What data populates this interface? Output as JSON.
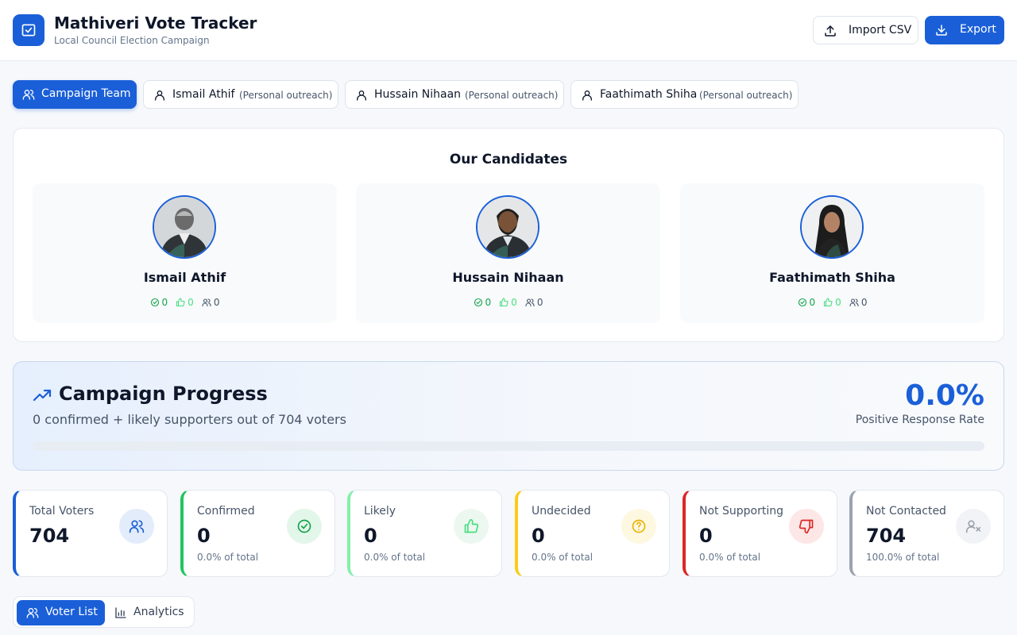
{
  "header": {
    "title": "Mathiveri Vote Tracker",
    "subtitle": "Local Council Election Campaign",
    "import_label": "Import CSV",
    "export_label": "Export"
  },
  "tabs": {
    "team_label": "Campaign Team",
    "candidates": [
      {
        "name": "Ismail Athif",
        "role": "(Personal outreach)"
      },
      {
        "name": "Hussain Nihaan",
        "role": "(Personal outreach)"
      },
      {
        "name": "Faathimath Shiha",
        "role": "(Personal outreach)"
      }
    ]
  },
  "candidates_panel": {
    "title": "Our Candidates",
    "cards": [
      {
        "name": "Ismail Athif",
        "confirmed": "0",
        "likely": "0",
        "total": "0"
      },
      {
        "name": "Hussain Nihaan",
        "confirmed": "0",
        "likely": "0",
        "total": "0"
      },
      {
        "name": "Faathimath Shiha",
        "confirmed": "0",
        "likely": "0",
        "total": "0"
      }
    ]
  },
  "progress": {
    "title": "Campaign Progress",
    "subtitle": "0 confirmed + likely supporters out of 704 voters",
    "rate": "0.0%",
    "rate_label": "Positive Response Rate",
    "fill_fraction": 0.0
  },
  "stats": [
    {
      "label": "Total Voters",
      "value": "704",
      "pct": "",
      "color": "#1a5fd8",
      "icon": "users-icon"
    },
    {
      "label": "Confirmed",
      "value": "0",
      "pct": "0.0% of total",
      "color": "#22c55e",
      "icon": "check-circle-icon"
    },
    {
      "label": "Likely",
      "value": "0",
      "pct": "0.0% of total",
      "color": "#86efac",
      "icon": "thumbs-up-icon"
    },
    {
      "label": "Undecided",
      "value": "0",
      "pct": "0.0% of total",
      "color": "#facc15",
      "icon": "question-circle-icon"
    },
    {
      "label": "Not Supporting",
      "value": "0",
      "pct": "0.0% of total",
      "color": "#dc2626",
      "icon": "thumbs-down-icon"
    },
    {
      "label": "Not Contacted",
      "value": "704",
      "pct": "100.0% of total",
      "color": "#9ca3af",
      "icon": "user-x-icon"
    }
  ],
  "view_switch": {
    "voter_list_label": "Voter List",
    "analytics_label": "Analytics"
  },
  "colors": {
    "primary": "#1a5fd8",
    "confirmed": "#16a34a",
    "likely": "#4ade80"
  }
}
